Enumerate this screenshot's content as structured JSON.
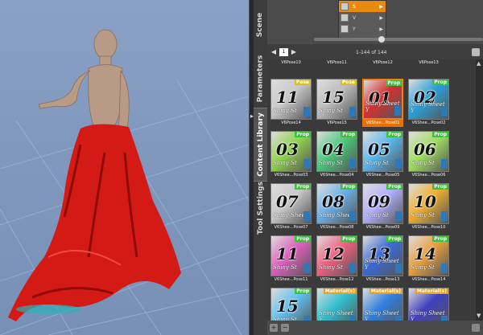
{
  "tabs": {
    "scene": "Scene",
    "parameters": "Parameters",
    "content_library": "Content Library",
    "tool_settings": "Tool Settings"
  },
  "scene_menu": [
    {
      "label": "S",
      "selected": true
    },
    {
      "label": "V",
      "selected": false
    },
    {
      "label": "Y",
      "selected": false
    }
  ],
  "pager": {
    "page": "1",
    "count": "1-144 of 144"
  },
  "top_labels": [
    "V6Pose10",
    "V6Pose11",
    "V6Pose12",
    "V6Pose13"
  ],
  "items": [
    {
      "num": "11",
      "badge": "Pose",
      "label": "V6Pose14",
      "brand": "Shiny St"
    },
    {
      "num": "15",
      "badge": "Pose",
      "label": "V6Pose15",
      "brand": "Shiny St"
    },
    {
      "num": "01",
      "badge": "Prop",
      "label": "V6Shee...Pose01",
      "brand": "Shiny Sheet Y",
      "selected": true
    },
    {
      "num": "02",
      "badge": "Prop",
      "label": "V6Shee...Pose02",
      "brand": "Shiny Sheet Y"
    },
    {
      "num": "03",
      "badge": "Prop",
      "label": "V6Shee...Pose03",
      "brand": "Shiny St"
    },
    {
      "num": "04",
      "badge": "Prop",
      "label": "V6Shee...Pose04",
      "brand": "Shiny St"
    },
    {
      "num": "05",
      "badge": "Prop",
      "label": "V6Shee...Pose05",
      "brand": "Shiny St"
    },
    {
      "num": "06",
      "badge": "Prop",
      "label": "V6Shee...Pose06",
      "brand": "Shiny St"
    },
    {
      "num": "07",
      "badge": "Prop",
      "label": "V6Shee...Pose07",
      "brand": "Shiny Sheet"
    },
    {
      "num": "08",
      "badge": "Prop",
      "label": "V6Shee...Pose08",
      "brand": "Shiny Sheet"
    },
    {
      "num": "09",
      "badge": "Prop",
      "label": "V6Shee...Pose09",
      "brand": "Shiny St"
    },
    {
      "num": "10",
      "badge": "Prop",
      "label": "V6Shee...Pose10",
      "brand": "Shiny St"
    },
    {
      "num": "11",
      "badge": "Prop",
      "label": "V6Shee...Pose11",
      "brand": "Shiny St"
    },
    {
      "num": "12",
      "badge": "Prop",
      "label": "V6Shee...Pose12",
      "brand": "Shiny St"
    },
    {
      "num": "13",
      "badge": "Prop",
      "label": "V6Shee...Pose13",
      "brand": "Shiny Sheet Y"
    },
    {
      "num": "14",
      "badge": "Prop",
      "label": "V6Shee...Pose14",
      "brand": "Shiny St"
    },
    {
      "num": "15",
      "badge": "Prop",
      "label": "",
      "brand": "Shiny St"
    },
    {
      "num": "",
      "badge": "Material(s)",
      "label": "",
      "brand": "Shiny Sheet Y"
    },
    {
      "num": "",
      "badge": "Material(s)",
      "label": "",
      "brand": "Shiny Sheet Y"
    },
    {
      "num": "",
      "badge": "Material(s)",
      "label": "",
      "brand": "Shiny Sheet Y"
    }
  ],
  "colors": {
    "accent": "#e8700a",
    "prop_badge": "#3fbf3f",
    "pose_badge": "#d8c020",
    "material_badge": "#e8a020",
    "dress": "#d41a14"
  },
  "icons": {
    "options": "menu-options-icon",
    "prev": "left-arrow-icon",
    "next": "right-arrow-icon"
  }
}
